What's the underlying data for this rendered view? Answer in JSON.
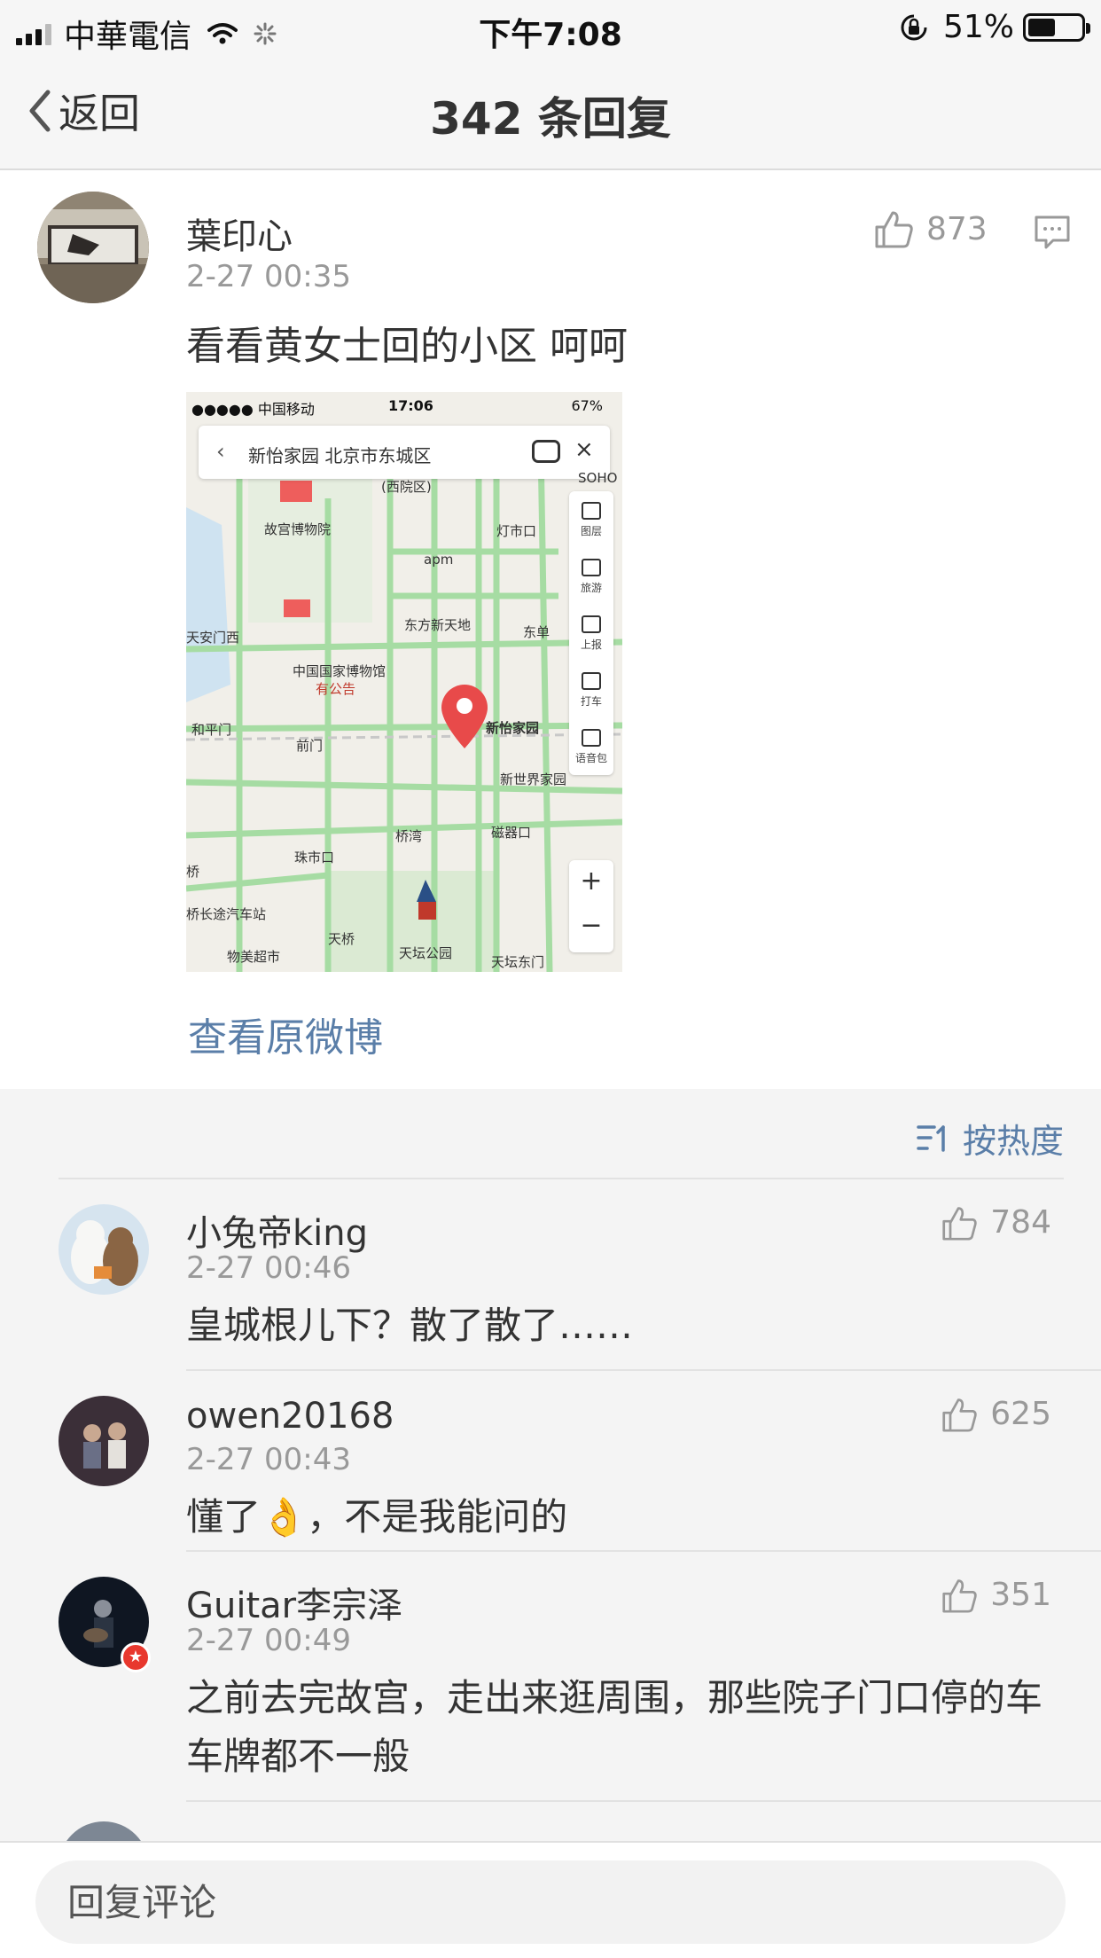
{
  "status_bar": {
    "carrier": "中華電信",
    "time": "下午7:08",
    "battery": "51%",
    "battery_level": 0.51
  },
  "nav": {
    "back_label": "返回",
    "title": "342 条回复"
  },
  "post": {
    "author": "葉印心",
    "time": "2-27 00:35",
    "text": "看看黄女士回的小区 呵呵",
    "likes": "873",
    "view_original": "查看原微博",
    "image": {
      "status_carrier": "●●●●● 中国移动",
      "status_time": "17:06",
      "status_battery": "67%",
      "search_text": "新怡家园 北京市东城区",
      "tools": [
        "图层",
        "旅游",
        "上报",
        "打车",
        "语音包"
      ],
      "labels": {
        "l1": "(西院区)",
        "l2": "故宫博物院",
        "l3": "灯市口",
        "l4": "apm",
        "l5": "东方新天地",
        "l6": "东单",
        "l7": "天安门西",
        "l8": "中国国家博物馆",
        "l9": "有公告",
        "l10": "新怡家园",
        "l11": "和平门",
        "l12": "前门",
        "l13": "新世界家园",
        "l14": "桥湾",
        "l15": "磁器口",
        "l16": "珠市口",
        "l17": "桥",
        "l18": "桥长途汽车站",
        "l19": "天桥",
        "l20": "天坛公园",
        "l21": "物美超市",
        "l22": "天坛东门",
        "l23": "SOHO"
      }
    }
  },
  "sort": {
    "label": "按热度"
  },
  "replies": [
    {
      "name": "小兔帝king",
      "time": "2-27 00:46",
      "text": "皇城根儿下？散了散了……",
      "likes": "784"
    },
    {
      "name": "owen20168",
      "time": "2-27 00:43",
      "text": "懂了👌，不是我能问的",
      "likes": "625"
    },
    {
      "name": "Guitar李宗泽",
      "time": "2-27 00:49",
      "text": "之前去完故宫，走出来逛周围，那些院子门口停的车车牌都不一般",
      "likes": "351"
    }
  ],
  "bottom": {
    "placeholder": "回复评论"
  },
  "colors": {
    "link_blue": "#5a7ea8",
    "muted_gray": "#999999",
    "section_bg": "#f4f4f4",
    "bar_bg": "#f6f6f6",
    "vip_red": "#e8382e"
  }
}
